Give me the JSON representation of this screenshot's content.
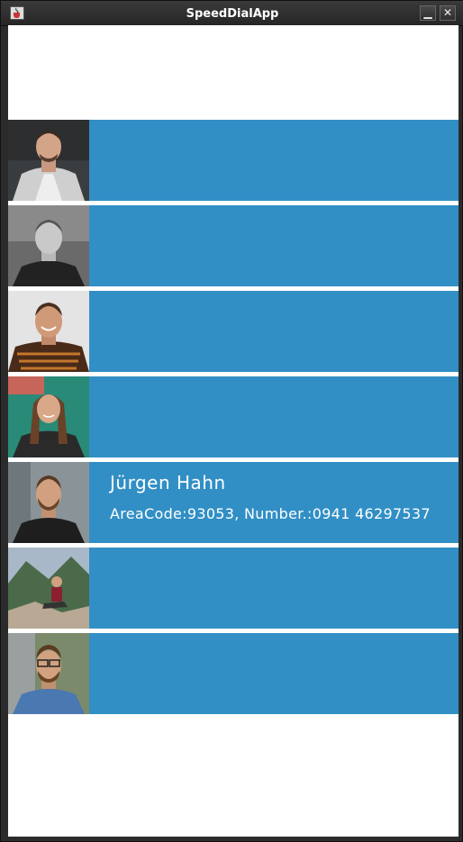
{
  "window": {
    "title": "SpeedDialApp",
    "app_icon": "java-cup-icon",
    "minimize_icon": "minimize-icon",
    "close_icon": "close-icon",
    "minimize_glyph": "▁",
    "close_glyph": "✕"
  },
  "colors": {
    "row_background": "#318fc5",
    "content_background": "#ffffff",
    "text": "#ffffff"
  },
  "contacts": [
    {
      "name": "",
      "detail": ""
    },
    {
      "name": "",
      "detail": ""
    },
    {
      "name": "",
      "detail": ""
    },
    {
      "name": "",
      "detail": ""
    },
    {
      "name": "Jürgen Hahn",
      "detail": "AreaCode:93053, Number.:0941 46297537"
    },
    {
      "name": "",
      "detail": ""
    },
    {
      "name": "",
      "detail": ""
    }
  ]
}
